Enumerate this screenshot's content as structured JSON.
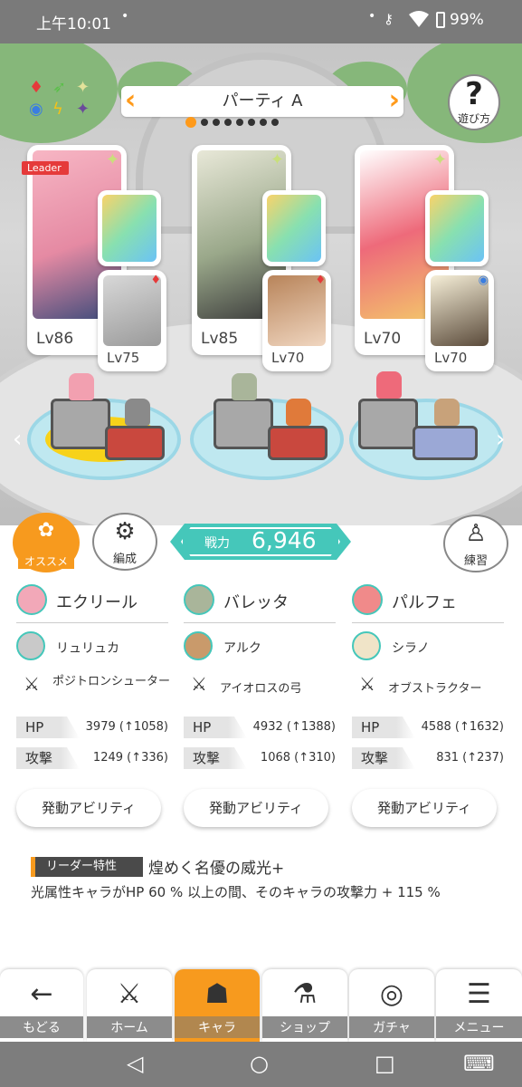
{
  "status_bar": {
    "time": "上午10:01",
    "dot": "•",
    "battery": "99%"
  },
  "header": {
    "party_name": "パーティ A",
    "page_count": 8,
    "active_page": 0,
    "help_label": "遊び方",
    "help_glyph": "?"
  },
  "leader_badge": "Leader",
  "party": [
    {
      "main_level": "Lv86",
      "sub_level": "Lv75",
      "main_name": "エクリール",
      "sub_name": "リュリュカ",
      "weapon": "ポジトロンシューター",
      "hp_label": "HP",
      "hp": "3979 (↑1058)",
      "atk_label": "攻撃",
      "atk": "1249 (↑336)",
      "ability_label": "発動アビリティ",
      "portrait_color": "#f2a8b8",
      "sub_color": "#c9c9c9"
    },
    {
      "main_level": "Lv85",
      "sub_level": "Lv70",
      "main_name": "バレッタ",
      "sub_name": "アルク",
      "weapon": "アイオロスの弓",
      "hp_label": "HP",
      "hp": "4932 (↑1388)",
      "atk_label": "攻撃",
      "atk": "1068 (↑310)",
      "ability_label": "発動アビリティ",
      "portrait_color": "#a9b59a",
      "sub_color": "#c99a6b"
    },
    {
      "main_level": "Lv70",
      "sub_level": "Lv70",
      "main_name": "パルフェ",
      "sub_name": "シラノ",
      "weapon": "オブストラクター",
      "hp_label": "HP",
      "hp": "4588 (↑1632)",
      "atk_label": "攻撃",
      "atk": "831 (↑237)",
      "ability_label": "発動アビリティ",
      "portrait_color": "#f08a8a",
      "sub_color": "#f0e4c8"
    }
  ],
  "actions": {
    "osusume": "オススメ",
    "hensei": "編成",
    "power_label": "戦力",
    "power_value": "6,946",
    "renshu": "練習"
  },
  "leader_trait": {
    "tag": "リーダー特性",
    "title": "煌めく名優の威光+",
    "description": "光属性キャラがHP 60 % 以上の間、そのキャラの攻撃力 + 115 %"
  },
  "nav": [
    {
      "label": "もどる",
      "icon": "back-arrow-icon",
      "glyph": "←"
    },
    {
      "label": "ホーム",
      "icon": "home-icon",
      "glyph": "⚔"
    },
    {
      "label": "キャラ",
      "icon": "chara-icon",
      "glyph": "☗"
    },
    {
      "label": "ショップ",
      "icon": "shop-icon",
      "glyph": "⚗"
    },
    {
      "label": "ガチャ",
      "icon": "gacha-icon",
      "glyph": "◎"
    },
    {
      "label": "メニュー",
      "icon": "menu-icon",
      "glyph": "☰"
    }
  ],
  "colors": {
    "accent": "#f79a1e",
    "teal": "#45c7ba",
    "leader_red": "#e53a3a"
  }
}
